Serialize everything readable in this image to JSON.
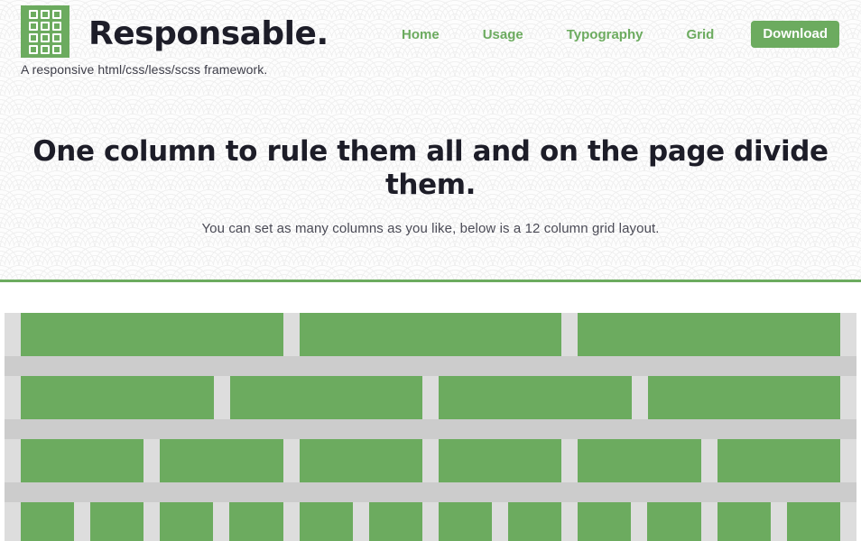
{
  "site": {
    "brand_name": "Responsable.",
    "tagline": "A responsive html/css/less/scss framework.",
    "logo_icon": "grid-squares-icon",
    "logo_cell_count": 12,
    "accent_color": "#6cab5f",
    "heading_color": "#1d1d28",
    "grid_track_color": "#dddddd",
    "grid_gap_band_color": "#cccccc",
    "background_pattern": "seigaiha-wave-pattern"
  },
  "nav": {
    "links": [
      {
        "label": "Home"
      },
      {
        "label": "Usage"
      },
      {
        "label": "Typography"
      },
      {
        "label": "Grid"
      }
    ],
    "download_label": "Download"
  },
  "hero": {
    "title": "One column to rule them all and on the page divide them.",
    "subtitle": "You can set as many columns as you like, below is a 12 column grid layout."
  },
  "grid_demo": {
    "total_columns": 12,
    "rows": [
      {
        "columns": 3,
        "span_each": 4
      },
      {
        "columns": 4,
        "span_each": 3
      },
      {
        "columns": 6,
        "span_each": 2
      },
      {
        "columns": 12,
        "span_each": 1
      }
    ]
  }
}
